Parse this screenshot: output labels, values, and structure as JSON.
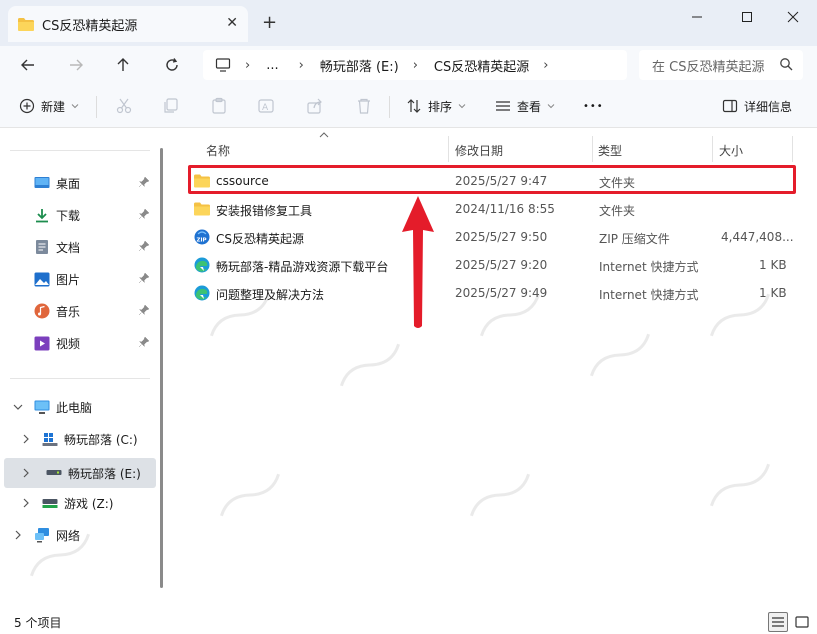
{
  "window": {
    "tab_title": "CS反恐精英起源",
    "new_tab": "+",
    "close_tab": "✕",
    "min": "—",
    "max": "☐",
    "close": "✕"
  },
  "address": {
    "segments": [
      "畅玩部落 (E:)",
      "CS反恐精英起源"
    ],
    "ellipsis": "...",
    "sep": "›"
  },
  "search": {
    "placeholder": "在 CS反恐精英起源"
  },
  "toolbar": {
    "new_label": "新建",
    "sort_label": "排序",
    "view_label": "查看",
    "more": "•••",
    "details_label": "详细信息"
  },
  "sidebar": {
    "quick": [
      {
        "label": "桌面",
        "icon": "desktop-icon"
      },
      {
        "label": "下载",
        "icon": "download-icon"
      },
      {
        "label": "文档",
        "icon": "document-icon"
      },
      {
        "label": "图片",
        "icon": "picture-icon"
      },
      {
        "label": "音乐",
        "icon": "music-icon"
      },
      {
        "label": "视频",
        "icon": "video-icon"
      }
    ],
    "this_pc": "此电脑",
    "drives": [
      {
        "label": "畅玩部落 (C:)"
      },
      {
        "label": "畅玩部落 (E:)"
      },
      {
        "label": "游戏 (Z:)"
      }
    ],
    "network": "网络"
  },
  "columns": {
    "name": "名称",
    "date": "修改日期",
    "type": "类型",
    "size": "大小"
  },
  "files": [
    {
      "name": "cssource",
      "date": "2025/5/27 9:47",
      "type": "文件夹",
      "size": "",
      "icon": "folder-icon"
    },
    {
      "name": "安装报错修复工具",
      "date": "2024/11/16 8:55",
      "type": "文件夹",
      "size": "",
      "icon": "folder-icon"
    },
    {
      "name": "CS反恐精英起源",
      "date": "2025/5/27 9:50",
      "type": "ZIP 压缩文件",
      "size": "4,447,408...",
      "icon": "zip-icon"
    },
    {
      "name": "畅玩部落-精品游戏资源下载平台",
      "date": "2025/5/27 9:20",
      "type": "Internet 快捷方式",
      "size": "1 KB",
      "icon": "edge-shortcut-icon"
    },
    {
      "name": "问题整理及解决方法",
      "date": "2025/5/27 9:49",
      "type": "Internet 快捷方式",
      "size": "1 KB",
      "icon": "edge-shortcut-icon"
    }
  ],
  "status": {
    "count": "5 个项目"
  },
  "colors": {
    "highlight": "#e41c2a",
    "folder": "#f4c144"
  }
}
